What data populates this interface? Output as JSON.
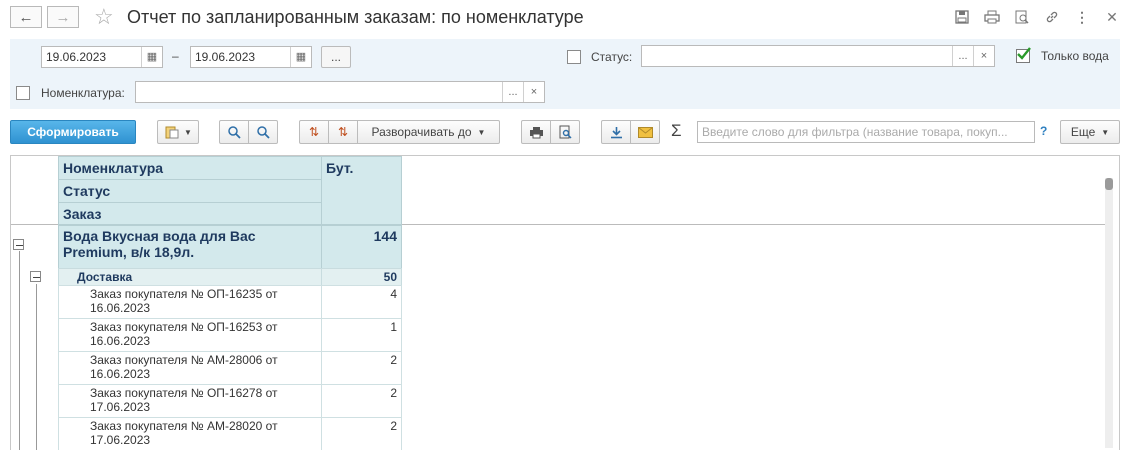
{
  "window": {
    "title": "Отчет по запланированным заказам: по номенклатуре"
  },
  "icons": [
    "back-icon",
    "forward-icon",
    "star-icon",
    "save-icon",
    "print-icon",
    "preview-icon",
    "link-icon",
    "more-vert-icon",
    "close-icon"
  ],
  "filters": {
    "date_from": "19.06.2023",
    "date_sep": "–",
    "date_to": "19.06.2023",
    "period_btn": "...",
    "status_label": "Статус:",
    "status_value": "",
    "only_water_label": "Только вода",
    "only_water_checked": true,
    "nomenclature_label": "Номенклатура:",
    "nomenclature_value": "",
    "select_btn": "...",
    "clear_btn": "×"
  },
  "toolbar": {
    "generate": "Сформировать",
    "expand_to": "Разворачивать до",
    "sum_symbol": "Σ",
    "filter_placeholder": "Введите слово для фильтра (название товара, покуп...",
    "help": "?",
    "more": "Еще"
  },
  "report": {
    "headers": {
      "nomenclature": "Номенклатура",
      "status": "Статус",
      "order": "Заказ",
      "qty": "Бут."
    },
    "group": {
      "name": "Вода Вкусная вода для Вас Premium, в/к 18,9л.",
      "qty": "144"
    },
    "subgroup": {
      "name": "Доставка",
      "qty": "50"
    },
    "rows": [
      {
        "order": "Заказ покупателя № ОП-16235 от 16.06.2023",
        "qty": "4"
      },
      {
        "order": "Заказ покупателя № ОП-16253 от 16.06.2023",
        "qty": "1"
      },
      {
        "order": "Заказ покупателя № АМ-28006 от 16.06.2023",
        "qty": "2"
      },
      {
        "order": "Заказ покупателя № ОП-16278 от 17.06.2023",
        "qty": "2"
      },
      {
        "order": "Заказ покупателя № АМ-28020 от 17.06.2023",
        "qty": "2"
      }
    ]
  },
  "colors": {
    "primary": "#3a9ad9",
    "header_bg": "#d3e9ec",
    "panel_bg": "#edf4fa",
    "check_green": "#2a9a2a"
  }
}
